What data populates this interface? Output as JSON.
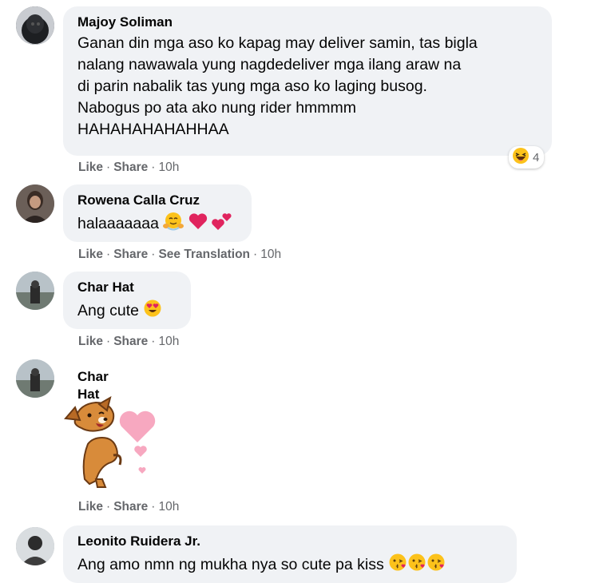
{
  "comments": [
    {
      "author": "Majoy Soliman",
      "lines": [
        "Ganan din mga aso ko kapag may deliver samin, tas bigla",
        "nalang nawawala yung nagdedeliver mga ilang araw na",
        "di parin nabalik tas yung mga aso ko laging busog.",
        "Nabogus po ata ako nung rider hmmmm",
        "HAHAHAHAHAHHAA"
      ],
      "like": "Like",
      "share": "Share",
      "time": "10h",
      "reaction_count": "4",
      "reaction_icon": "haha-reaction-icon"
    },
    {
      "author": "Rowena Calla Cruz",
      "text": "halaaaaaaa",
      "emojis": [
        "hugging-face-icon",
        "red-heart-icon",
        "two-hearts-icon"
      ],
      "like": "Like",
      "share": "Share",
      "translate": "See Translation",
      "time": "10h"
    },
    {
      "author": "Char Hat",
      "text": "Ang cute",
      "emojis": [
        "heart-eyes-icon"
      ],
      "like": "Like",
      "share": "Share",
      "time": "10h"
    },
    {
      "author": "Char Hat",
      "sticker": "dog-hearts-sticker",
      "like": "Like",
      "share": "Share",
      "time": "10h"
    },
    {
      "author": "Leonito Ruidera Jr.",
      "text": "Ang amo nmn ng mukha nya so cute pa kiss",
      "emojis": [
        "kissing-face-icon",
        "kissing-face-icon",
        "kissing-face-icon"
      ]
    }
  ],
  "colors": {
    "bubble": "#f0f2f5",
    "meta_text": "#65676b",
    "emoji_yellow": "#fcc21b",
    "heart_red": "#e0245e",
    "heart_pink": "#f7a8c0"
  }
}
